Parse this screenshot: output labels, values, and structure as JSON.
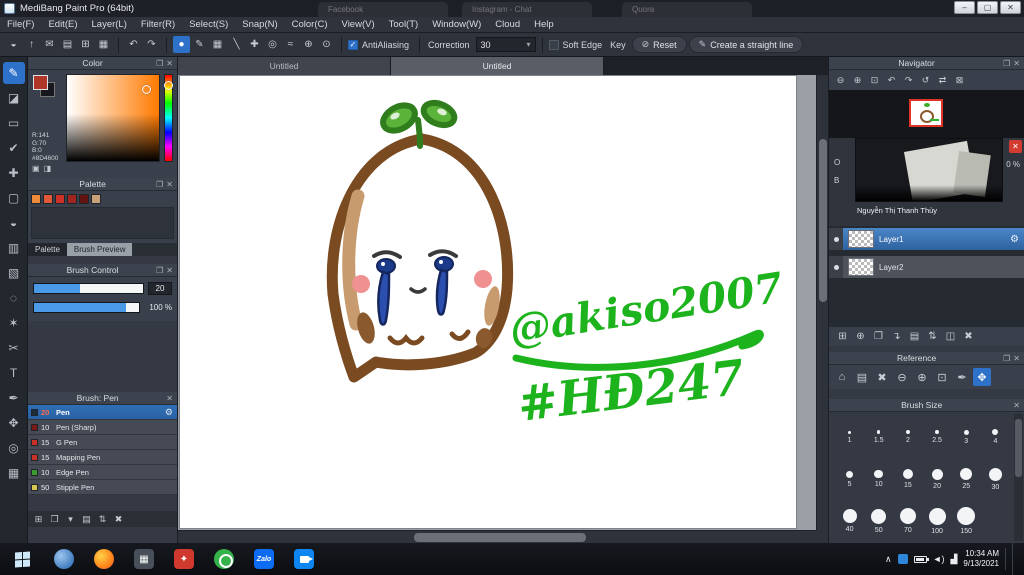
{
  "window": {
    "title": "MediBang Paint Pro (64bit)",
    "background_tabs": [
      "Facebook",
      "Instagram - Chat",
      "Quora"
    ],
    "controls": [
      {
        "name": "minimize-button",
        "glyph": "–"
      },
      {
        "name": "maximize-button",
        "glyph": "▢"
      },
      {
        "name": "close-button",
        "glyph": "✕"
      }
    ]
  },
  "menu": {
    "items": [
      "File(F)",
      "Edit(E)",
      "Layer(L)",
      "Filter(R)",
      "Select(S)",
      "Snap(N)",
      "Color(C)",
      "View(V)",
      "Tool(T)",
      "Window(W)",
      "Cloud",
      "Help"
    ]
  },
  "toolbar": {
    "file_icons": [
      {
        "name": "paint-bucket-icon",
        "glyph": "◒"
      },
      {
        "name": "upload-icon",
        "glyph": "↑"
      },
      {
        "name": "comment-icon",
        "glyph": "✉"
      },
      {
        "name": "page-icon",
        "glyph": "▤"
      },
      {
        "name": "grid-small-icon",
        "glyph": "⊞"
      },
      {
        "name": "grid-large-icon",
        "glyph": "▦"
      }
    ],
    "undo_icons": [
      {
        "name": "undo-icon",
        "glyph": "↶"
      },
      {
        "name": "redo-icon",
        "glyph": "↷"
      }
    ],
    "brush_icons": [
      {
        "name": "brush-circle-icon",
        "glyph": "●",
        "active": true
      },
      {
        "name": "pen-icon",
        "glyph": "✎"
      },
      {
        "name": "pattern-icon",
        "glyph": "▦"
      }
    ],
    "snap_icons": [
      {
        "name": "snap-parallel-icon",
        "glyph": "╲"
      },
      {
        "name": "snap-cross-icon",
        "glyph": "✚"
      },
      {
        "name": "snap-vanish-icon",
        "glyph": "◎"
      },
      {
        "name": "snap-curve-icon",
        "glyph": "≈"
      },
      {
        "name": "snap-circle-icon",
        "glyph": "⊕"
      },
      {
        "name": "snap-radial-icon",
        "glyph": "⊙"
      }
    ],
    "antialiasing_label": "AntiAliasing",
    "antialiasing_checked": true,
    "correction_label": "Correction",
    "correction_value": "30",
    "soft_edge_label": "Soft Edge",
    "soft_edge_checked": false,
    "key_label": "Key",
    "reset_label": "Reset",
    "straight_line_label": "Create a straight line"
  },
  "tools": {
    "items": [
      {
        "name": "brush-tool",
        "glyph": "✎",
        "active": true
      },
      {
        "name": "eraser-tool",
        "glyph": "◪"
      },
      {
        "name": "rectangle-tool",
        "glyph": "▭"
      },
      {
        "name": "select-pen-tool",
        "glyph": "✔"
      },
      {
        "name": "move-tool",
        "glyph": "✚"
      },
      {
        "name": "fill-rect-tool",
        "glyph": "▢"
      },
      {
        "name": "bucket-tool",
        "glyph": "◒"
      },
      {
        "name": "gradient-tool",
        "glyph": "▥"
      },
      {
        "name": "select-tool",
        "glyph": "▧"
      },
      {
        "name": "lasso-tool",
        "glyph": "◌"
      },
      {
        "name": "magic-wand-tool",
        "glyph": "✶"
      },
      {
        "name": "divide-tool",
        "glyph": "✂"
      },
      {
        "name": "text-tool",
        "glyph": "T"
      },
      {
        "name": "eyedropper-tool",
        "glyph": "✒"
      },
      {
        "name": "hand-tool",
        "glyph": "✥"
      },
      {
        "name": "zoom-tool",
        "glyph": "◎"
      },
      {
        "name": "grid-tool",
        "glyph": "▦"
      }
    ]
  },
  "left_panels": {
    "color": {
      "title": "Color",
      "r_label": "R:141",
      "g_label": "G:70",
      "b_label": "B:0",
      "hex": "#8D4600"
    },
    "palette": {
      "title": "Palette",
      "swatches": [
        {
          "c": "#ef8a3a"
        },
        {
          "c": "#e2593a"
        },
        {
          "c": "#cf3028"
        },
        {
          "c": "#a02420"
        },
        {
          "c": "#641410"
        },
        {
          "c": "#c9a078"
        }
      ],
      "tabs": [
        "Palette",
        "Brush Preview"
      ]
    },
    "brush_control": {
      "title": "Brush Control",
      "slider1_value": "20",
      "slider1_fill": 42,
      "slider2_value": "100 %",
      "slider2_fill": 88
    },
    "brush_list": {
      "title": "Brush: Pen",
      "items": [
        {
          "size": "20",
          "name": "Pen",
          "selected": true,
          "swatch": "#1c2b3a"
        },
        {
          "size": "10",
          "name": "Pen (Sharp)",
          "swatch": "#7a1a14"
        },
        {
          "size": "15",
          "name": "G Pen",
          "swatch": "#c93026"
        },
        {
          "size": "15",
          "name": "Mapping Pen",
          "swatch": "#c93026"
        },
        {
          "size": "10",
          "name": "Edge Pen",
          "swatch": "#3c9a30"
        },
        {
          "size": "50",
          "name": "Stipple Pen",
          "swatch": "#d6c84e"
        }
      ]
    }
  },
  "canvas": {
    "tabs": [
      {
        "label": "Untitled",
        "active": false
      },
      {
        "label": "Untitled",
        "active": true
      }
    ],
    "art": {
      "line1": "@akiso2007",
      "line2": "#HĐ247",
      "green": "#1db31d",
      "outline": "#7a4a21",
      "tears": "#2a4fae",
      "leaf": "#5cb33a",
      "cheek": "#ef9191"
    }
  },
  "right_panels": {
    "navigator": {
      "title": "Navigator",
      "icons": [
        {
          "name": "zoom-out-icon",
          "glyph": "⊖"
        },
        {
          "name": "zoom-in-icon",
          "glyph": "⊕"
        },
        {
          "name": "zoom-fit-icon",
          "glyph": "⊡"
        },
        {
          "name": "rotate-left-icon",
          "glyph": "↶"
        },
        {
          "name": "rotate-right-icon",
          "glyph": "↷"
        },
        {
          "name": "rotate-reset-icon",
          "glyph": "↺"
        },
        {
          "name": "flip-icon",
          "glyph": "⇄"
        },
        {
          "name": "nav-settings-icon",
          "glyph": "⊠"
        }
      ]
    },
    "layer_overlay": {
      "caption": "Nguyễn Thị Thanh Thủy",
      "left_partial1": "O",
      "left_partial2": "B",
      "right_partial": "0 %"
    },
    "layers": {
      "items": [
        {
          "name": "Layer1",
          "selected": true
        },
        {
          "name": "Layer2",
          "selected": false
        }
      ],
      "toolbar": [
        {
          "name": "add-layer-icon",
          "glyph": "⊞"
        },
        {
          "name": "add-folder-icon",
          "glyph": "⊕"
        },
        {
          "name": "duplicate-layer-icon",
          "glyph": "❐"
        },
        {
          "name": "merge-down-icon",
          "glyph": "↴"
        },
        {
          "name": "folder-icon",
          "glyph": "▤"
        },
        {
          "name": "reorder-icon",
          "glyph": "⇅"
        },
        {
          "name": "transfer-icon",
          "glyph": "◫"
        },
        {
          "name": "delete-layer-icon",
          "glyph": "✖"
        }
      ]
    },
    "reference": {
      "title": "Reference",
      "icons": [
        {
          "name": "home-icon",
          "glyph": "⌂"
        },
        {
          "name": "open-folder-icon",
          "glyph": "▤"
        },
        {
          "name": "clear-icon",
          "glyph": "✖"
        },
        {
          "name": "zoom-out-icon",
          "glyph": "⊖"
        },
        {
          "name": "zoom-in-icon",
          "glyph": "⊕"
        },
        {
          "name": "zoom-fit-icon",
          "glyph": "⊡"
        },
        {
          "name": "eyedropper-icon",
          "glyph": "✒"
        },
        {
          "name": "hand-icon",
          "glyph": "✥",
          "active": true
        }
      ]
    },
    "brush_size": {
      "title": "Brush Size",
      "items": [
        {
          "label": "1",
          "dot": 3
        },
        {
          "label": "1.5",
          "dot": 3.5
        },
        {
          "label": "2",
          "dot": 4
        },
        {
          "label": "2.5",
          "dot": 4.5
        },
        {
          "label": "3",
          "dot": 5
        },
        {
          "label": "4",
          "dot": 6
        },
        {
          "label": "5",
          "dot": 7
        },
        {
          "label": "10",
          "dot": 8.5
        },
        {
          "label": "15",
          "dot": 10
        },
        {
          "label": "20",
          "dot": 11
        },
        {
          "label": "25",
          "dot": 12
        },
        {
          "label": "30",
          "dot": 13
        },
        {
          "label": "40",
          "dot": 14
        },
        {
          "label": "50",
          "dot": 15
        },
        {
          "label": "70",
          "dot": 16
        },
        {
          "label": "100",
          "dot": 17
        },
        {
          "label": "150",
          "dot": 18
        }
      ]
    }
  },
  "taskbar": {
    "apps": [
      "browser",
      "firefox",
      "utility",
      "photo-app",
      "coccoc",
      "zalo",
      "video-call"
    ],
    "zalo_label": "Zalo",
    "tray": {
      "time": "10:34 AM",
      "date": "9/13/2021"
    }
  }
}
